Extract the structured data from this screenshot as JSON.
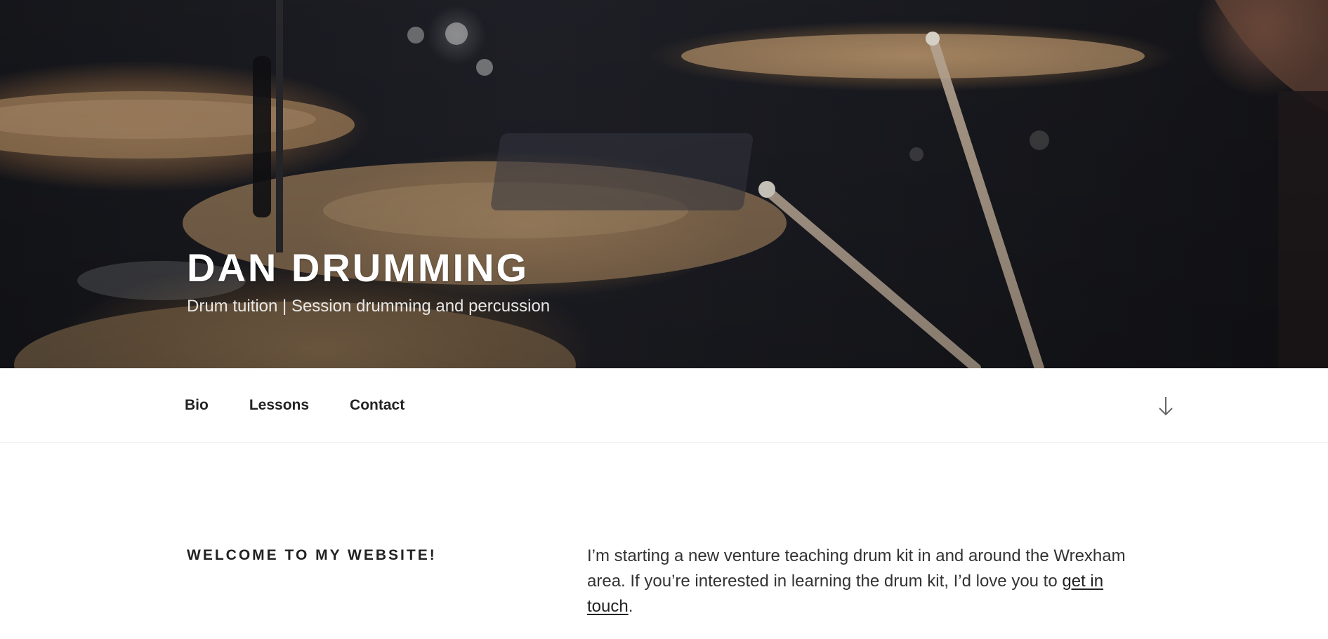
{
  "header": {
    "site_title": "DAN DRUMMING",
    "tagline": "Drum tuition | Session drumming and percussion"
  },
  "nav": {
    "items": [
      {
        "label": "Bio"
      },
      {
        "label": "Lessons"
      },
      {
        "label": "Contact"
      }
    ],
    "scroll_icon": "arrow-down-icon"
  },
  "content": {
    "heading": "WELCOME TO MY WEBSITE!",
    "paragraph_before_link": "I’m starting a new venture teaching drum kit in and around the Wrexham area. If you’re interested in learning the drum kit, I’d love you to ",
    "link_text": "get in touch",
    "paragraph_after_link": "."
  },
  "colors": {
    "text_dark": "#222222",
    "body_text": "#333333",
    "hero_dark": "#1a1b21",
    "cymbal_bronze": "#a98560"
  }
}
